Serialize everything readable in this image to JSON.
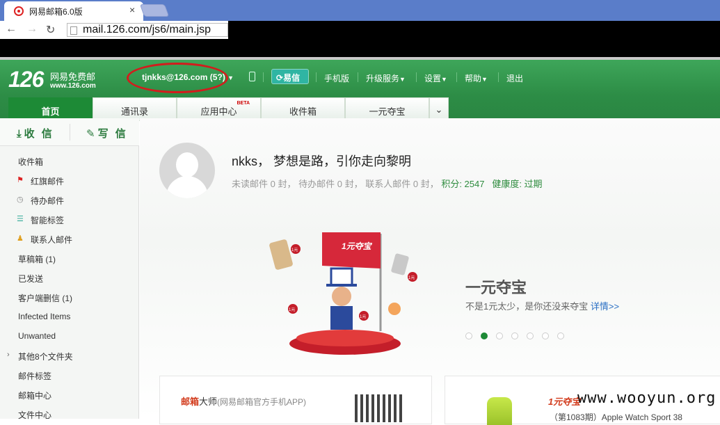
{
  "browser": {
    "tab_title": "网易邮箱6.0版",
    "tab_close": "×",
    "url": "mail.126.com/js6/main.jsp"
  },
  "header": {
    "logo_number": "126",
    "logo_text": "网易免费邮",
    "logo_url": "www.126.com",
    "user": "tjnkks@126.com (5?)",
    "yixin": "易信",
    "nav": [
      "手机版",
      "升级服务",
      "设置",
      "帮助",
      "退出"
    ],
    "highlight_color": "#d21d1d"
  },
  "tabs": [
    {
      "label": "首页"
    },
    {
      "label": "通讯录"
    },
    {
      "label": "应用中心",
      "badge": "BETA"
    },
    {
      "label": "收件箱"
    },
    {
      "label": "一元夺宝"
    }
  ],
  "sidebar": {
    "receive": "收 信",
    "write": "写 信",
    "folders": [
      {
        "label": "收件箱"
      },
      {
        "label": "红旗邮件",
        "icon": "flag-icon"
      },
      {
        "label": "待办邮件",
        "icon": "clock-icon"
      },
      {
        "label": "智能标签",
        "icon": "tag-stack-icon"
      },
      {
        "label": "联系人邮件",
        "icon": "person-icon"
      },
      {
        "label": "草稿箱 (1)"
      },
      {
        "label": "已发送"
      },
      {
        "label": "客户端删信 (1)"
      },
      {
        "label": "Infected Items"
      },
      {
        "label": "Unwanted"
      },
      {
        "label": "其他8个文件夹",
        "icon": "chevron-right-icon"
      },
      {
        "label": "邮件标签"
      },
      {
        "label": "邮箱中心"
      },
      {
        "label": "文件中心"
      }
    ]
  },
  "main": {
    "greeting": "nkks， 梦想是路，引你走向黎明",
    "stats": {
      "unread": "未读邮件 0 封",
      "todo": "待办邮件 0 封",
      "contacts": "联系人邮件 0 封",
      "points": "积分: 2547",
      "health": "健康度: 过期",
      "sep": "，"
    },
    "promo": {
      "title": "一元夺宝",
      "subtitle": "不是1元太少，是你还没来夺宝",
      "link": "详情>>",
      "flag_text": "1元夺宝",
      "badge": "1元",
      "dots": 7,
      "active_dot": 1
    },
    "card1": {
      "brand_a": "邮箱",
      "brand_b": "大师",
      "desc": "(网易邮箱官方手机APP)"
    },
    "card2": {
      "logo": "1元夺宝",
      "product": "（第1083期）Apple Watch Sport 38"
    }
  },
  "watermark": "www.wooyun.org"
}
